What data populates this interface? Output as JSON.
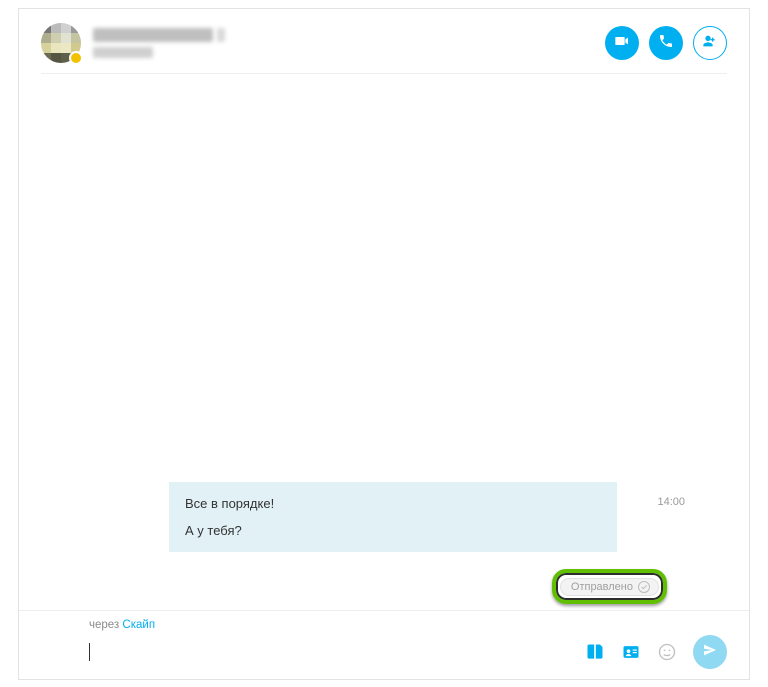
{
  "header": {
    "contact_name": "█████ ████████",
    "contact_status_line": "████████",
    "presence": "away"
  },
  "actions": {
    "video_call": "Видеозвонок",
    "audio_call": "Звонок",
    "add_people": "Добавить участников"
  },
  "message": {
    "line1": "Все в порядке!",
    "line2": "А у тебя?",
    "time": "14:00",
    "status_label": "Отправлено"
  },
  "footer": {
    "via_prefix": "через ",
    "via_link": "Скайп",
    "input_value": "",
    "input_placeholder": ""
  },
  "icons": {
    "video": "video-icon",
    "phone": "phone-icon",
    "add_user": "add-user-icon",
    "attach": "attach-file-icon",
    "contact_card": "contact-card-icon",
    "emoji": "emoji-icon",
    "send": "send-icon",
    "tick": "checkmark-icon"
  },
  "colors": {
    "brand": "#00aff0",
    "bubble": "#e2f1f6",
    "highlight": "#5fbf00"
  }
}
